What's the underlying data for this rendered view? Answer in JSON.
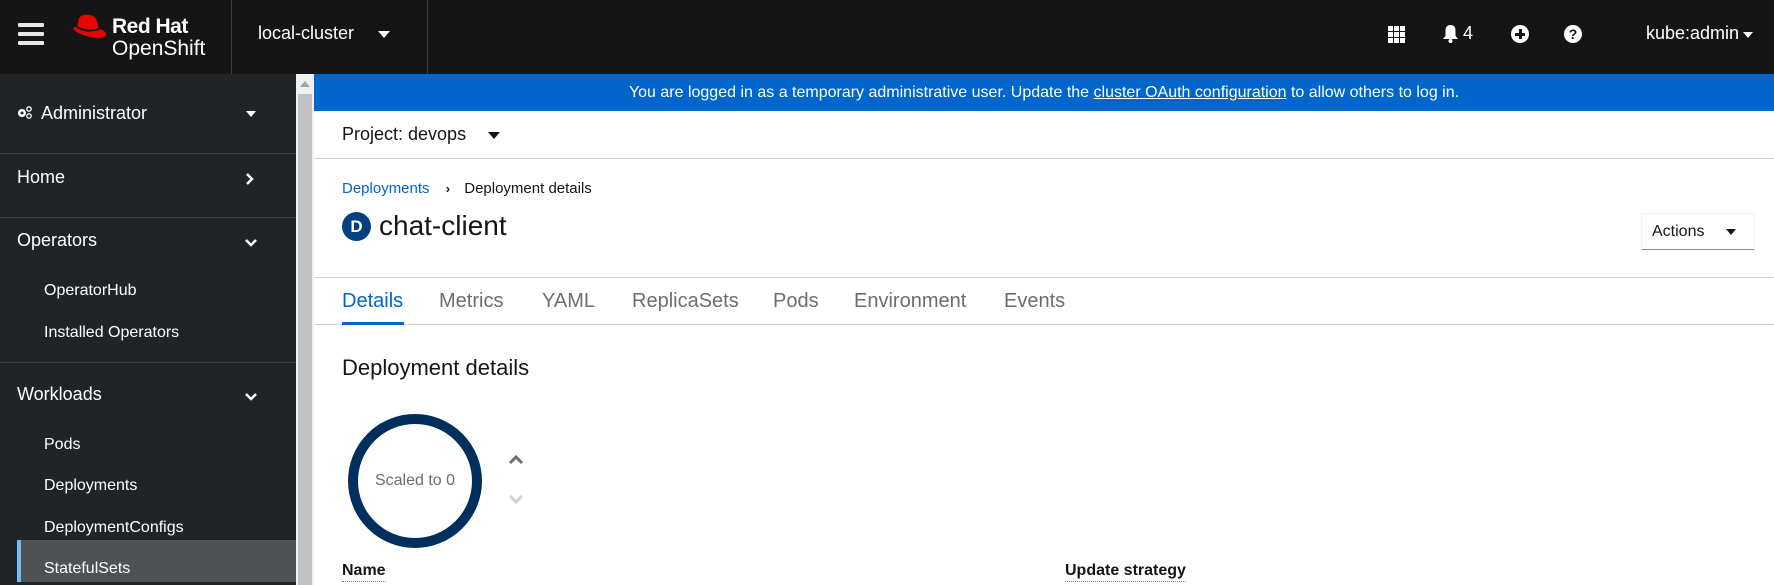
{
  "masthead": {
    "brand_line1": "Red Hat",
    "brand_line2": "OpenShift",
    "cluster": "local-cluster",
    "notifications_count": "4",
    "user": "kube:admin",
    "icons": [
      "menu-icon",
      "app-launcher-icon",
      "bell-icon",
      "plus-circle-icon",
      "question-circle-icon"
    ]
  },
  "sidebar": {
    "perspective": "Administrator",
    "sections": [
      {
        "label": "Home",
        "expanded": false,
        "items": []
      },
      {
        "label": "Operators",
        "expanded": true,
        "items": [
          "OperatorHub",
          "Installed Operators"
        ]
      },
      {
        "label": "Workloads",
        "expanded": true,
        "items": [
          "Pods",
          "Deployments",
          "DeploymentConfigs",
          "StatefulSets"
        ]
      }
    ],
    "active_item": "Deployments"
  },
  "banner": {
    "text_before": "You are logged in as a temporary administrative user. Update the ",
    "link": "cluster OAuth configuration",
    "text_after": " to allow others to log in."
  },
  "project": {
    "label": "Project: devops"
  },
  "breadcrumb": {
    "parent": "Deployments",
    "current": "Deployment details"
  },
  "page": {
    "kind_badge": "D",
    "title": "chat-client",
    "actions_label": "Actions"
  },
  "tabs": [
    {
      "label": "Details",
      "active": true
    },
    {
      "label": "Metrics",
      "active": false
    },
    {
      "label": "YAML",
      "active": false
    },
    {
      "label": "ReplicaSets",
      "active": false
    },
    {
      "label": "Pods",
      "active": false
    },
    {
      "label": "Environment",
      "active": false
    },
    {
      "label": "Events",
      "active": false
    }
  ],
  "details": {
    "section_title": "Deployment details",
    "pod_ring_label": "Scaled to 0",
    "pod_count": 0,
    "fields": [
      "Name",
      "Update strategy"
    ]
  },
  "colors": {
    "masthead_bg": "#151515",
    "sidebar_bg": "#212427",
    "banner_bg": "#0066cc",
    "link": "#0066cc",
    "active_nav_indicator": "#73bcf7",
    "ring": "#002f5d"
  }
}
